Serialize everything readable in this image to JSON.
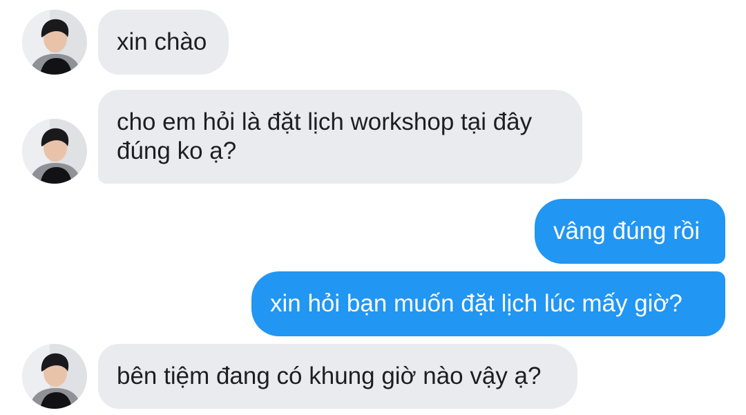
{
  "messages": [
    {
      "side": "incoming",
      "line1": "xin chào",
      "line2": ""
    },
    {
      "side": "incoming",
      "line1": "cho em hỏi là đặt lịch workshop tại đây",
      "line2": "đúng ko ạ?"
    },
    {
      "side": "outgoing",
      "line1": "vâng đúng rồi",
      "line2": ""
    },
    {
      "side": "outgoing",
      "line1": "xin hỏi bạn muốn đặt lịch lúc mấy giờ?",
      "line2": ""
    },
    {
      "side": "incoming",
      "line1": "bên tiệm đang có khung giờ nào vậy ạ?",
      "line2": ""
    }
  ],
  "colors": {
    "incoming_bubble": "#e9ebef",
    "outgoing_bubble": "#2196f3",
    "incoming_text": "#1c1e21",
    "outgoing_text": "#ffffff"
  },
  "icons": {
    "sender_avatar": "profile-photo-avatar"
  }
}
